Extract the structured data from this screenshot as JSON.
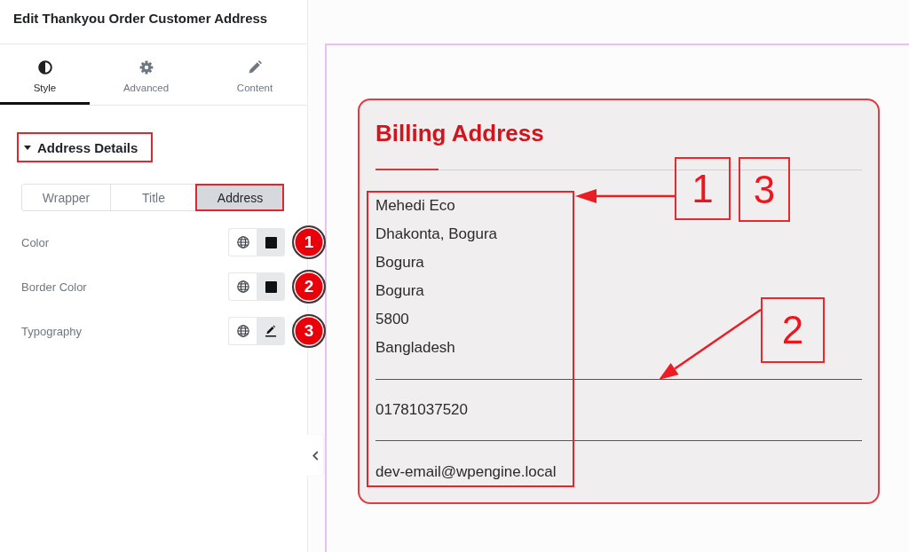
{
  "panel": {
    "title": "Edit Thankyou Order Customer Address",
    "tabs": [
      {
        "label": "Style",
        "selected": true
      },
      {
        "label": "Advanced",
        "selected": false
      },
      {
        "label": "Content",
        "selected": false
      }
    ],
    "section": {
      "title": "Address Details",
      "expanded": true,
      "highlighted": true
    },
    "segments": [
      {
        "label": "Wrapper",
        "selected": false,
        "highlighted": false
      },
      {
        "label": "Title",
        "selected": false,
        "highlighted": false
      },
      {
        "label": "Address",
        "selected": true,
        "highlighted": true
      }
    ],
    "controls": [
      {
        "label": "Color",
        "kind": "color",
        "badge": "1"
      },
      {
        "label": "Border Color",
        "kind": "color",
        "badge": "2"
      },
      {
        "label": "Typography",
        "kind": "typography",
        "badge": "3"
      }
    ]
  },
  "preview": {
    "card": {
      "title": "Billing Address",
      "address_lines": [
        "Mehedi Eco",
        "Dhakonta, Bogura",
        "Bogura",
        "Bogura",
        "5800",
        "Bangladesh"
      ],
      "phone": "01781037520",
      "email": "dev-email@wpengine.local",
      "highlighted": true
    },
    "callouts": [
      {
        "label": "1"
      },
      {
        "label": "3"
      },
      {
        "label": "2"
      }
    ]
  }
}
